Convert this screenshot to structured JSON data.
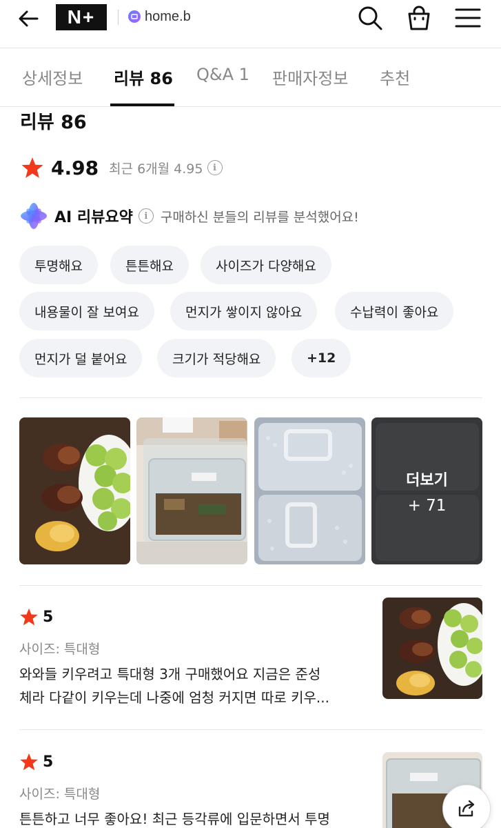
{
  "header": {
    "logo_text": "N+",
    "store_name": "home.b"
  },
  "tabs": [
    {
      "label": "상세정보"
    },
    {
      "label": "리뷰 86"
    },
    {
      "label": "Q&A 1"
    },
    {
      "label": "판매자정보"
    },
    {
      "label": "추천"
    }
  ],
  "reviews_section": {
    "title": "리뷰 86",
    "rating": "4.98",
    "recent_label": "최근 6개월 4.95",
    "ai_title": "AI 리뷰요약",
    "ai_desc": "구매하신 분들의 리뷰를 분석했어요!",
    "keywords": [
      "투명해요",
      "튼튼해요",
      "사이즈가 다양해요",
      "내용물이 잘 보여요",
      "먼지가 쌓이지 않아요",
      "수납력이 좋아요",
      "먼지가 덜 붙어요",
      "크기가 적당해요",
      "+12"
    ],
    "photos_more_label": "더보기",
    "photos_more_count": "+ 71"
  },
  "reviews": [
    {
      "score": "5",
      "size": "사이즈: 특대형",
      "line1": "와와들 키우려고 특대형 3개 구매했어요 지금은 준성",
      "line2": "체라 다같이 키우는데 나중에 엄청 커지면 따로 키우..."
    },
    {
      "score": "5",
      "size": "사이즈: 특대형",
      "line1": "튼튼하고 너무 좋아요! 최근 등각류에 입문하면서 투명"
    }
  ],
  "colors": {
    "star": "#f2391c",
    "chip_bg": "#f1f3f6",
    "accent_text": "#111111"
  },
  "icons": [
    "back-arrow-icon",
    "search-icon",
    "shopping-bag-icon",
    "hamburger-menu-icon",
    "star-icon",
    "info-icon",
    "ai-sparkle-icon",
    "share-icon"
  ]
}
